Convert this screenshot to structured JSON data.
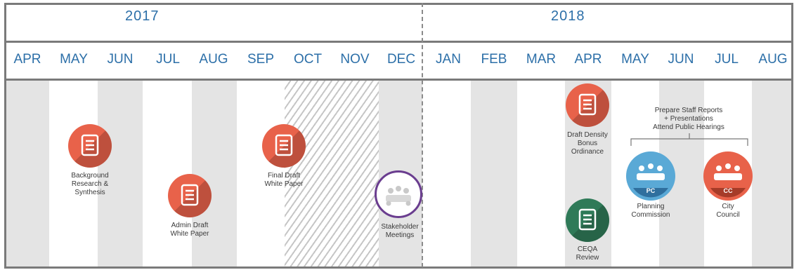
{
  "years": [
    "2017",
    "2018"
  ],
  "months": [
    "APR",
    "MAY",
    "JUN",
    "JUL",
    "AUG",
    "SEP",
    "OCT",
    "NOV",
    "DEC",
    "JAN",
    "FEB",
    "MAR",
    "APR",
    "MAY",
    "JUN",
    "JUL",
    "AUG"
  ],
  "milestones": {
    "background_research": "Background\nResearch &\nSynthesis",
    "admin_draft": "Admin Draft\nWhite Paper",
    "final_draft": "Final Draft\nWhite Paper",
    "stakeholder_meetings": "Stakeholder\nMeetings",
    "draft_density": "Draft Density\nBonus\nOrdinance",
    "ceqa_review": "CEQA\nReview",
    "staff_reports": "Prepare Staff Reports\n+ Presentations\nAttend Public Hearings",
    "planning_commission": "Planning\nCommission",
    "city_council": "City\nCouncil"
  },
  "badges": {
    "pc": "PC",
    "cc": "CC"
  },
  "colors": {
    "accent_text": "#2c6fa8",
    "doc_orange": "#e8624a",
    "doc_green": "#2f7a58",
    "meeting_blue": "#5aa9d6",
    "meeting_orange": "#e8624a",
    "stakeholder_purple": "#6a3d8f"
  },
  "icons": [
    "document-icon",
    "meeting-table-icon"
  ]
}
